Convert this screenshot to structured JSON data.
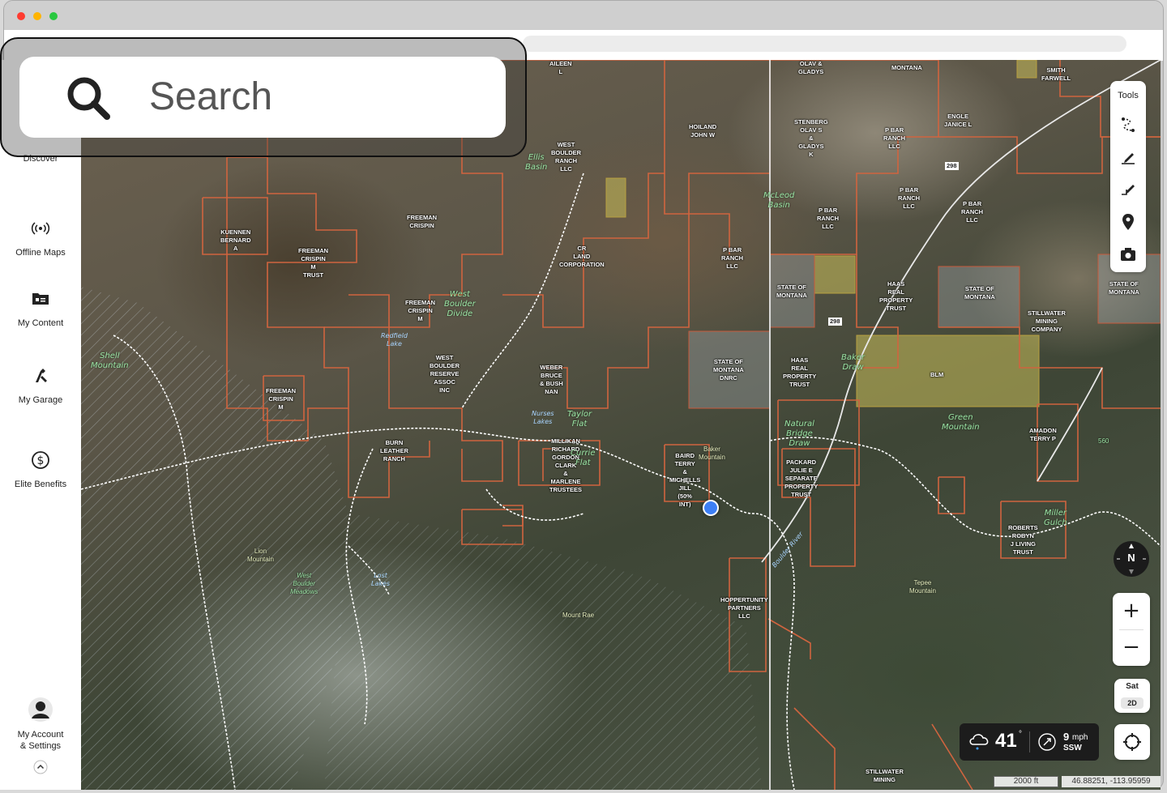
{
  "search": {
    "placeholder": "Search"
  },
  "sidebar": {
    "items": [
      {
        "label": "Discover",
        "icon": "discover-icon"
      },
      {
        "label": "Offline Maps",
        "icon": "offline-maps-icon"
      },
      {
        "label": "My Content",
        "icon": "my-content-icon"
      },
      {
        "label": "My Garage",
        "icon": "garage-icon"
      },
      {
        "label": "Elite Benefits",
        "icon": "dollar-icon"
      }
    ],
    "account": {
      "label_line1": "My Account",
      "label_line2": "& Settings"
    }
  },
  "tools": {
    "title": "Tools"
  },
  "compass": {
    "label": "N"
  },
  "layer": {
    "name": "Sat",
    "mode": "2D"
  },
  "weather": {
    "temperature": "41",
    "degree": "°",
    "wind_speed": "9",
    "wind_unit": "mph",
    "wind_direction": "SSW"
  },
  "scale": {
    "label": "2000 ft"
  },
  "coordinates": {
    "label": "46.88251, -113.95959"
  },
  "map_labels": {
    "owners": [
      "AILEEN\nL",
      "OLAV &\nGLADYS",
      "MONTANA",
      "SMITH\nFARWELL",
      "HOILAND\nJOHN W",
      "STENBERG\nOLAV S\n&\nGLADYS\nK",
      "P BAR\nRANCH\nLLC",
      "ENGLE\nJANICE L",
      "WEST\nBOULDER\nRANCH\nLLC",
      "FREEMAN\nCRISPIN",
      "KUENNEN\nBERNARD\nA",
      "FREEMAN\nCRISPIN\nM\nTRUST",
      "CR\nLAND\nCORPORATION",
      "P BAR\nRANCH\nLLC",
      "P BAR\nRANCH\nLLC",
      "P BAR\nRANCH\nLLC",
      "P BAR\nRANCH\nLLC",
      "STATE OF\nMONTANA",
      "HAAS\nREAL\nPROPERTY\nTRUST",
      "STATE OF\nMONTANA",
      "STATE OF\nMONTANA",
      "FREEMAN\nCRISPIN\nM",
      "STILLWATER\nMINING\nCOMPANY",
      "WEST\nBOULDER\nRESERVE\nASSOC\nINC",
      "WEBER\nBRUCE\n& BUSH\nNAN",
      "STATE OF\nMONTANA\nDNRC",
      "HAAS\nREAL\nPROPERTY\nTRUST",
      "BLM",
      "FREEMAN\nCRISPIN\nM",
      "BURN\nLEATHER\nRANCH",
      "MILLIKAN\nRICHARD\nGORDON\nCLARK\n&\nMARLENE\nTRUSTEES",
      "BAIRD\nTERRY\n&\nMICHELLS\nJILL\n(50%\nINT)",
      "PACKARD\nJULIE E\nSEPARATE\nPROPERTY\nTRUST",
      "AMADON\nTERRY P",
      "ROBERTS\nROBYN\nJ LIVING\nTRUST",
      "HOPPERTUNITY\nPARTNERS\nLLC",
      "STILLWATER\nMINING"
    ],
    "places": [
      "Ellis\nBasin",
      "McLeod\nBasin",
      "West\nBoulder\nDivide",
      "Shell\nMountain",
      "Taylor\nFlat",
      "Currie\nFlat",
      "Green\nMountain",
      "Baker\nDraw",
      "Natural\nBridge\nDraw",
      "Miller\nGulch"
    ],
    "water": [
      "Redfield\nLake",
      "Nurses\nLakes",
      "Boulder River",
      "Lost\nLakes"
    ],
    "pois": [
      "Baker\nMountain",
      "Lion\nMountain",
      "West\nBoulder\nMeadows",
      "Mount Rae",
      "Tepee\nMountain",
      "560"
    ],
    "roads": [
      "298",
      "298"
    ]
  }
}
